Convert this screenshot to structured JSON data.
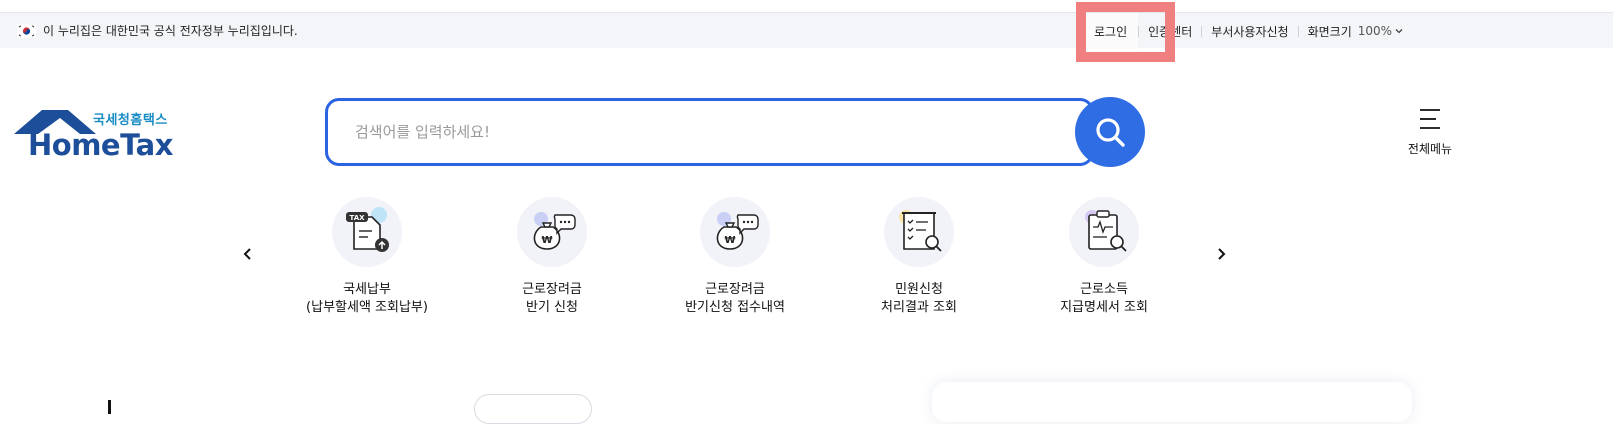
{
  "topbar": {
    "gov_notice": "이 누리집은 대한민국 공식 전자정부 누리집입니다.",
    "links": {
      "login": "로그인",
      "cert_center": "인증센터",
      "dept_user": "부서사용자신청",
      "screen_size": "화면크기",
      "zoom_value": "100%"
    }
  },
  "logo": {
    "sub": "국세청홈택스",
    "main": "HomeTax",
    "brand_color": "#1d4e9a",
    "accent_color": "#1a8cc4"
  },
  "search": {
    "placeholder": "검색어를 입력하세요!",
    "accent_color": "#2f6de5"
  },
  "menu": {
    "all_label": "전체메뉴"
  },
  "quick_menu": [
    {
      "line1": "국세납부",
      "line2": "(납부할세액 조회납부)",
      "icon": "tax-upload-icon"
    },
    {
      "line1": "근로장려금",
      "line2": "반기 신청",
      "icon": "money-bag-chat-icon"
    },
    {
      "line1": "근로장려금",
      "line2": "반기신청 접수내역",
      "icon": "money-bag-chat-icon"
    },
    {
      "line1": "민원신청",
      "line2": "처리결과 조회",
      "icon": "checklist-search-icon"
    },
    {
      "line1": "근로소득",
      "line2": "지급명세서 조회",
      "icon": "clipboard-search-icon"
    }
  ]
}
